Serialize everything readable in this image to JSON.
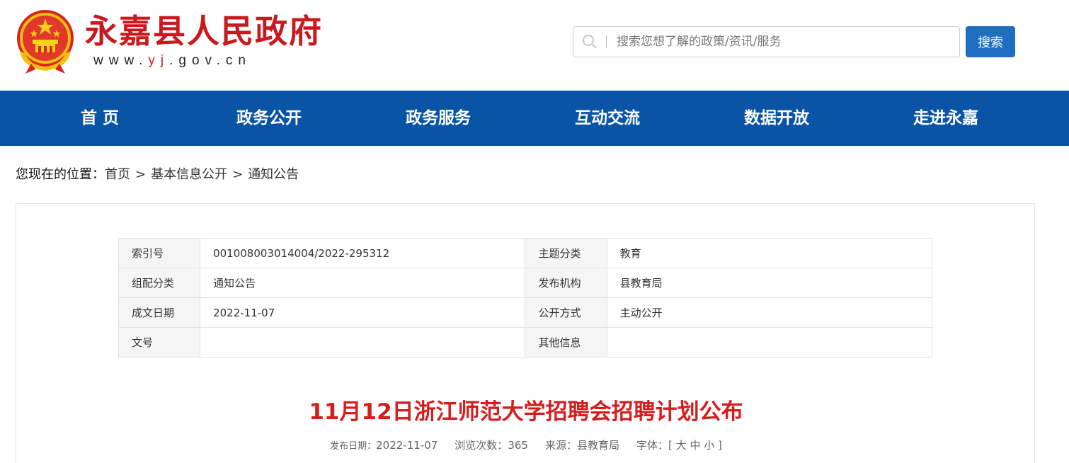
{
  "header": {
    "site_title": "永嘉县人民政府",
    "url_prefix": "www.",
    "url_highlight": "yj",
    "url_suffix": ".gov.cn",
    "emblem_icon": "national-emblem-icon"
  },
  "search": {
    "placeholder": "搜索您想了解的政策/资讯/服务",
    "button_label": "搜索"
  },
  "nav": {
    "items": [
      "首 页",
      "政务公开",
      "政务服务",
      "互动交流",
      "数据开放",
      "走进永嘉"
    ]
  },
  "breadcrumb": {
    "prefix": "您现在的位置：",
    "items": [
      "首页",
      "基本信息公开",
      "通知公告"
    ],
    "separator": ">"
  },
  "meta_table": {
    "rows": [
      {
        "l1": "索引号",
        "v1": "001008003014004/2022-295312",
        "l2": "主题分类",
        "v2": "教育"
      },
      {
        "l1": "组配分类",
        "v1": "通知公告",
        "l2": "发布机构",
        "v2": "县教育局"
      },
      {
        "l1": "成文日期",
        "v1": "2022-11-07",
        "l2": "公开方式",
        "v2": "主动公开"
      },
      {
        "l1": "文号",
        "v1": "",
        "l2": "其他信息",
        "v2": ""
      }
    ]
  },
  "article": {
    "title": "11月12日浙江师范大学招聘会招聘计划公布",
    "publish_label": "发布日期：",
    "publish_date": "2022-11-07",
    "views_label": "浏览次数：",
    "views": "365",
    "source_label": "来源：",
    "source": "县教育局",
    "font_label": "字体：",
    "font_open": "[",
    "font_large": "大",
    "font_medium": "中",
    "font_small": "小",
    "font_close": "]"
  },
  "colors": {
    "brand_red": "#c9191e",
    "nav_blue": "#0a54a5",
    "button_blue": "#1e6fc1",
    "title_red": "#d61d1d"
  }
}
